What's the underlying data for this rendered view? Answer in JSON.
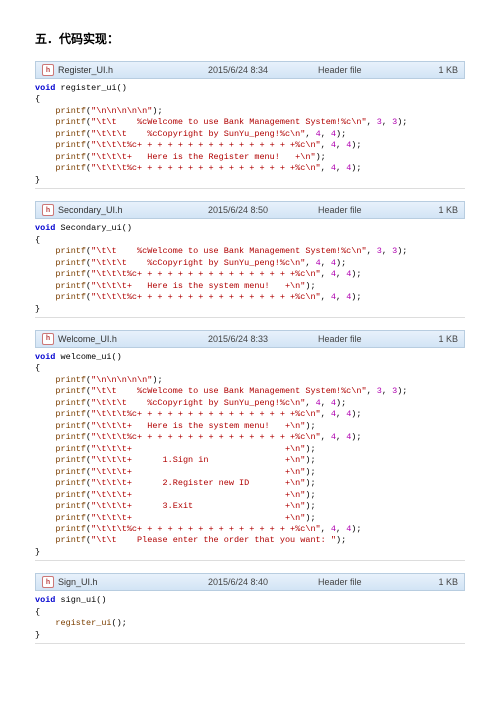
{
  "heading": "五．代码实现：",
  "files": [
    {
      "icon": "h",
      "name": "Register_UI.h",
      "date": "2015/6/24 8:34",
      "type": "Header file",
      "size": "1 KB",
      "code_lines": [
        [
          [
            "kw",
            "void"
          ],
          [
            "plain",
            " "
          ],
          [
            "fn",
            "register_ui"
          ],
          [
            "paren",
            "()"
          ]
        ],
        [
          [
            "brace",
            "{"
          ]
        ],
        [
          [
            "plain",
            "    "
          ],
          [
            "call",
            "printf"
          ],
          [
            "punct",
            "("
          ],
          [
            "str",
            "\"\\n\\n\\n\\n\\n\""
          ],
          [
            "punct",
            ");"
          ]
        ],
        [
          [
            "plain",
            "    "
          ],
          [
            "call",
            "printf"
          ],
          [
            "punct",
            "("
          ],
          [
            "str",
            "\"\\t\\t    %cWelcome to use Bank Management System!%c\\n\""
          ],
          [
            "punct",
            ", "
          ],
          [
            "num",
            "3"
          ],
          [
            "punct",
            ", "
          ],
          [
            "num",
            "3"
          ],
          [
            "punct",
            ");"
          ]
        ],
        [
          [
            "plain",
            "    "
          ],
          [
            "call",
            "printf"
          ],
          [
            "punct",
            "("
          ],
          [
            "str",
            "\"\\t\\t\\t    %cCopyright by SunYu_peng!%c\\n\""
          ],
          [
            "punct",
            ", "
          ],
          [
            "num",
            "4"
          ],
          [
            "punct",
            ", "
          ],
          [
            "num",
            "4"
          ],
          [
            "punct",
            ");"
          ]
        ],
        [
          [
            "plain",
            "    "
          ],
          [
            "call",
            "printf"
          ],
          [
            "punct",
            "("
          ],
          [
            "str",
            "\"\\t\\t\\t%c+ + + + + + + + + + + + + + + +%c\\n\""
          ],
          [
            "punct",
            ", "
          ],
          [
            "num",
            "4"
          ],
          [
            "punct",
            ", "
          ],
          [
            "num",
            "4"
          ],
          [
            "punct",
            ");"
          ]
        ],
        [
          [
            "plain",
            "    "
          ],
          [
            "call",
            "printf"
          ],
          [
            "punct",
            "("
          ],
          [
            "str",
            "\"\\t\\t\\t+   Here is the Register menu!   +\\n\""
          ],
          [
            "punct",
            ");"
          ]
        ],
        [
          [
            "plain",
            "    "
          ],
          [
            "call",
            "printf"
          ],
          [
            "punct",
            "("
          ],
          [
            "str",
            "\"\\t\\t\\t%c+ + + + + + + + + + + + + + + +%c\\n\""
          ],
          [
            "punct",
            ", "
          ],
          [
            "num",
            "4"
          ],
          [
            "punct",
            ", "
          ],
          [
            "num",
            "4"
          ],
          [
            "punct",
            ");"
          ]
        ],
        [
          [
            "brace",
            "}"
          ]
        ]
      ]
    },
    {
      "icon": "h",
      "name": "Secondary_UI.h",
      "date": "2015/6/24 8:50",
      "type": "Header file",
      "size": "1 KB",
      "code_lines": [
        [
          [
            "kw",
            "void"
          ],
          [
            "plain",
            " "
          ],
          [
            "fn",
            "Secondary_ui"
          ],
          [
            "paren",
            "()"
          ]
        ],
        [
          [
            "brace",
            "{"
          ]
        ],
        [
          [
            "plain",
            "    "
          ],
          [
            "call",
            "printf"
          ],
          [
            "punct",
            "("
          ],
          [
            "str",
            "\"\\t\\t    %cWelcome to use Bank Management System!%c\\n\""
          ],
          [
            "punct",
            ", "
          ],
          [
            "num",
            "3"
          ],
          [
            "punct",
            ", "
          ],
          [
            "num",
            "3"
          ],
          [
            "punct",
            ");"
          ]
        ],
        [
          [
            "plain",
            "    "
          ],
          [
            "call",
            "printf"
          ],
          [
            "punct",
            "("
          ],
          [
            "str",
            "\"\\t\\t\\t    %cCopyright by SunYu_peng!%c\\n\""
          ],
          [
            "punct",
            ", "
          ],
          [
            "num",
            "4"
          ],
          [
            "punct",
            ", "
          ],
          [
            "num",
            "4"
          ],
          [
            "punct",
            ");"
          ]
        ],
        [
          [
            "plain",
            "    "
          ],
          [
            "call",
            "printf"
          ],
          [
            "punct",
            "("
          ],
          [
            "str",
            "\"\\t\\t\\t%c+ + + + + + + + + + + + + + + +%c\\n\""
          ],
          [
            "punct",
            ", "
          ],
          [
            "num",
            "4"
          ],
          [
            "punct",
            ", "
          ],
          [
            "num",
            "4"
          ],
          [
            "punct",
            ");"
          ]
        ],
        [
          [
            "plain",
            "    "
          ],
          [
            "call",
            "printf"
          ],
          [
            "punct",
            "("
          ],
          [
            "str",
            "\"\\t\\t\\t+   Here is the system menu!   +\\n\""
          ],
          [
            "punct",
            ");"
          ]
        ],
        [
          [
            "plain",
            "    "
          ],
          [
            "call",
            "printf"
          ],
          [
            "punct",
            "("
          ],
          [
            "str",
            "\"\\t\\t\\t%c+ + + + + + + + + + + + + + + +%c\\n\""
          ],
          [
            "punct",
            ", "
          ],
          [
            "num",
            "4"
          ],
          [
            "punct",
            ", "
          ],
          [
            "num",
            "4"
          ],
          [
            "punct",
            ");"
          ]
        ],
        [
          [
            "brace",
            "}"
          ]
        ]
      ]
    },
    {
      "icon": "h",
      "name": "Welcome_UI.h",
      "date": "2015/6/24 8:33",
      "type": "Header file",
      "size": "1 KB",
      "code_lines": [
        [
          [
            "kw",
            "void"
          ],
          [
            "plain",
            " "
          ],
          [
            "fn",
            "welcome_ui"
          ],
          [
            "paren",
            "()"
          ]
        ],
        [
          [
            "brace",
            "{"
          ]
        ],
        [
          [
            "plain",
            "    "
          ],
          [
            "call",
            "printf"
          ],
          [
            "punct",
            "("
          ],
          [
            "str",
            "\"\\n\\n\\n\\n\\n\""
          ],
          [
            "punct",
            ");"
          ]
        ],
        [
          [
            "plain",
            "    "
          ],
          [
            "call",
            "printf"
          ],
          [
            "punct",
            "("
          ],
          [
            "str",
            "\"\\t\\t    %cWelcome to use Bank Management System!%c\\n\""
          ],
          [
            "punct",
            ", "
          ],
          [
            "num",
            "3"
          ],
          [
            "punct",
            ", "
          ],
          [
            "num",
            "3"
          ],
          [
            "punct",
            ");"
          ]
        ],
        [
          [
            "plain",
            "    "
          ],
          [
            "call",
            "printf"
          ],
          [
            "punct",
            "("
          ],
          [
            "str",
            "\"\\t\\t\\t    %cCopyright by SunYu_peng!%c\\n\""
          ],
          [
            "punct",
            ", "
          ],
          [
            "num",
            "4"
          ],
          [
            "punct",
            ", "
          ],
          [
            "num",
            "4"
          ],
          [
            "punct",
            ");"
          ]
        ],
        [
          [
            "plain",
            "    "
          ],
          [
            "call",
            "printf"
          ],
          [
            "punct",
            "("
          ],
          [
            "str",
            "\"\\t\\t\\t%c+ + + + + + + + + + + + + + + +%c\\n\""
          ],
          [
            "punct",
            ", "
          ],
          [
            "num",
            "4"
          ],
          [
            "punct",
            ", "
          ],
          [
            "num",
            "4"
          ],
          [
            "punct",
            ");"
          ]
        ],
        [
          [
            "plain",
            "    "
          ],
          [
            "call",
            "printf"
          ],
          [
            "punct",
            "("
          ],
          [
            "str",
            "\"\\t\\t\\t+   Here is the system menu!   +\\n\""
          ],
          [
            "punct",
            ");"
          ]
        ],
        [
          [
            "plain",
            "    "
          ],
          [
            "call",
            "printf"
          ],
          [
            "punct",
            "("
          ],
          [
            "str",
            "\"\\t\\t\\t%c+ + + + + + + + + + + + + + + +%c\\n\""
          ],
          [
            "punct",
            ", "
          ],
          [
            "num",
            "4"
          ],
          [
            "punct",
            ", "
          ],
          [
            "num",
            "4"
          ],
          [
            "punct",
            ");"
          ]
        ],
        [
          [
            "plain",
            "    "
          ],
          [
            "call",
            "printf"
          ],
          [
            "punct",
            "("
          ],
          [
            "str",
            "\"\\t\\t\\t+                              +\\n\""
          ],
          [
            "punct",
            ");"
          ]
        ],
        [
          [
            "plain",
            "    "
          ],
          [
            "call",
            "printf"
          ],
          [
            "punct",
            "("
          ],
          [
            "str",
            "\"\\t\\t\\t+      1.Sign in               +\\n\""
          ],
          [
            "punct",
            ");"
          ]
        ],
        [
          [
            "plain",
            "    "
          ],
          [
            "call",
            "printf"
          ],
          [
            "punct",
            "("
          ],
          [
            "str",
            "\"\\t\\t\\t+                              +\\n\""
          ],
          [
            "punct",
            ");"
          ]
        ],
        [
          [
            "plain",
            "    "
          ],
          [
            "call",
            "printf"
          ],
          [
            "punct",
            "("
          ],
          [
            "str",
            "\"\\t\\t\\t+      2.Register new ID       +\\n\""
          ],
          [
            "punct",
            ");"
          ]
        ],
        [
          [
            "plain",
            "    "
          ],
          [
            "call",
            "printf"
          ],
          [
            "punct",
            "("
          ],
          [
            "str",
            "\"\\t\\t\\t+                              +\\n\""
          ],
          [
            "punct",
            ");"
          ]
        ],
        [
          [
            "plain",
            "    "
          ],
          [
            "call",
            "printf"
          ],
          [
            "punct",
            "("
          ],
          [
            "str",
            "\"\\t\\t\\t+      3.Exit                  +\\n\""
          ],
          [
            "punct",
            ");"
          ]
        ],
        [
          [
            "plain",
            "    "
          ],
          [
            "call",
            "printf"
          ],
          [
            "punct",
            "("
          ],
          [
            "str",
            "\"\\t\\t\\t+                              +\\n\""
          ],
          [
            "punct",
            ");"
          ]
        ],
        [
          [
            "plain",
            "    "
          ],
          [
            "call",
            "printf"
          ],
          [
            "punct",
            "("
          ],
          [
            "str",
            "\"\\t\\t\\t%c+ + + + + + + + + + + + + + + +%c\\n\""
          ],
          [
            "punct",
            ", "
          ],
          [
            "num",
            "4"
          ],
          [
            "punct",
            ", "
          ],
          [
            "num",
            "4"
          ],
          [
            "punct",
            ");"
          ]
        ],
        [
          [
            "plain",
            "    "
          ],
          [
            "call",
            "printf"
          ],
          [
            "punct",
            "("
          ],
          [
            "str",
            "\"\\t\\t    Please enter the order that you want: \""
          ],
          [
            "punct",
            ");"
          ]
        ],
        [
          [
            "brace",
            "}"
          ]
        ]
      ]
    },
    {
      "icon": "h",
      "name": "Sign_UI.h",
      "date": "2015/6/24 8:40",
      "type": "Header file",
      "size": "1 KB",
      "code_lines": [
        [
          [
            "kw",
            "void"
          ],
          [
            "plain",
            " "
          ],
          [
            "fn",
            "sign_ui"
          ],
          [
            "paren",
            "()"
          ]
        ],
        [
          [
            "brace",
            "{"
          ]
        ],
        [
          [
            "plain",
            "    "
          ],
          [
            "call",
            "register_ui"
          ],
          [
            "paren",
            "()"
          ],
          [
            "punct",
            ";"
          ]
        ],
        [
          [
            "brace",
            "}"
          ]
        ]
      ]
    }
  ]
}
